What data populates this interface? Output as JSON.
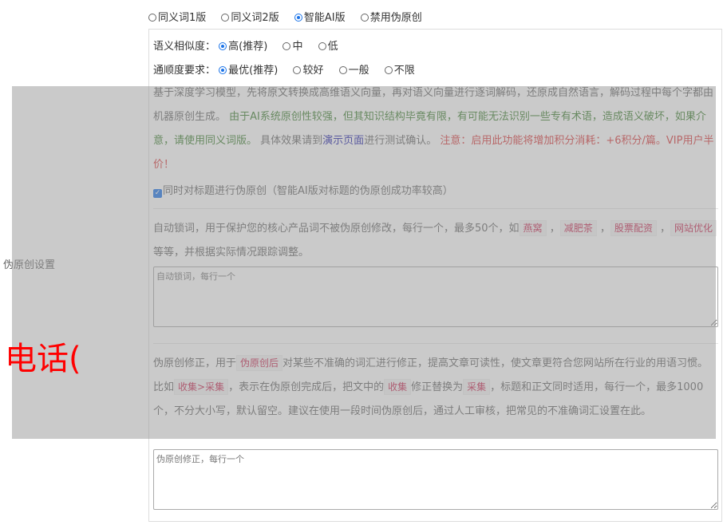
{
  "version_options": [
    {
      "label": "同义词1版",
      "checked": false
    },
    {
      "label": "同义词2版",
      "checked": false
    },
    {
      "label": "智能AI版",
      "checked": true
    },
    {
      "label": "禁用伪原创",
      "checked": false
    }
  ],
  "left_label": "伪原创设置",
  "similarity": {
    "label": "语义相似度：",
    "options": [
      {
        "label": "高(推荐)",
        "checked": true
      },
      {
        "label": "中",
        "checked": false
      },
      {
        "label": "低",
        "checked": false
      }
    ]
  },
  "fluency": {
    "label": "通顺度要求：",
    "options": [
      {
        "label": "最优(推荐)",
        "checked": true
      },
      {
        "label": "较好",
        "checked": false
      },
      {
        "label": "一般",
        "checked": false
      },
      {
        "label": "不限",
        "checked": false
      }
    ]
  },
  "ai_desc": {
    "plain1": "基于深度学习模型，先将原文转换成高维语义向量，再对语义向量进行逐词解码，还原成自然语言，解码过程中每个字都由机器原创生成。",
    "green": "由于AI系统原创性较强，但其知识结构毕竟有限，有可能无法识别一些专有术语，造成语义破坏，如果介意，请使用同义词版。",
    "plain2": "具体效果请到",
    "link": "演示页面",
    "plain3": "进行测试确认。",
    "red": "注意：启用此功能将增加积分消耗：+6积分/篇。VIP用户半价！"
  },
  "title_checkbox_label": "同时对标题进行伪原创（智能AI版对标题的伪原创成功率较高）",
  "lock_words": {
    "desc_before": "自动锁词，用于保护您的核心产品词不被伪原创修改，每行一个，最多50个，如",
    "examples": [
      "燕窝",
      "减肥茶",
      "股票配资",
      "网站优化"
    ],
    "desc_after": "等等，并根据实际情况跟踪调整。",
    "placeholder": "自动锁词，每行一个"
  },
  "correction": {
    "desc1": "伪原创修正，用于",
    "tag1": "伪原创后",
    "desc2": "对某些不准确的词汇进行修正，提高文章可读性，使文章更符合您网站所在行业的用语习惯。比如",
    "tag2": "收集>采集",
    "desc3": "，表示在伪原创完成后，把文中的",
    "tag3": "收集",
    "desc4": "修正替换为",
    "tag4": "采集",
    "desc5": "，标题和正文同时适用，每行一个，最多1000个，不分大小写，默认留空。建议在使用一段时间伪原创后，通过人工审核，把常见的不准确词汇设置在此。",
    "placeholder": "伪原创修正，每行一个"
  },
  "overlay_text": "电话(",
  "colors": {
    "accent": "#1a73e8",
    "green": "#3a7d2c",
    "red": "#d9383a",
    "overlay_text": "#ff0000"
  }
}
